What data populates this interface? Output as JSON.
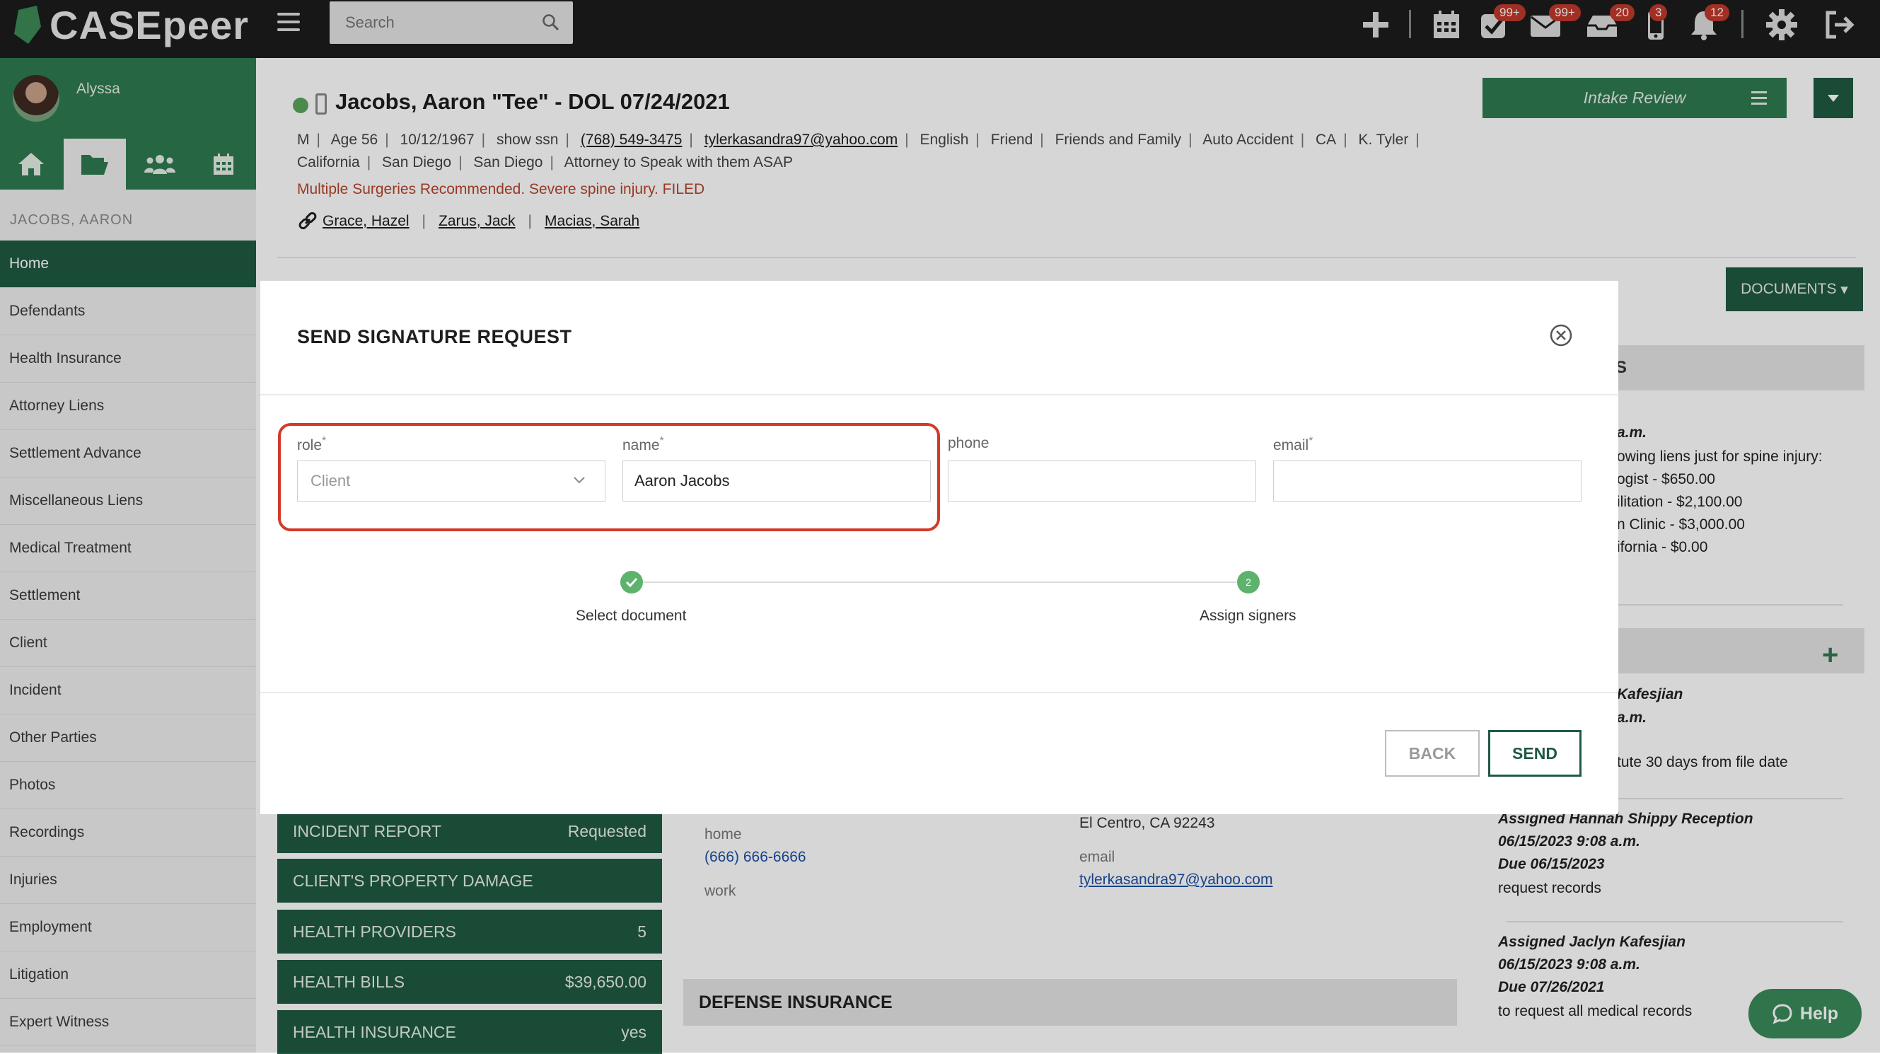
{
  "app": {
    "brand": "CASEpeer"
  },
  "topbar": {
    "search_placeholder": "Search",
    "badges": {
      "tasks": "99+",
      "mail": "99+",
      "inbox": "20",
      "phone": "3",
      "notifications": "12"
    }
  },
  "sidebar": {
    "user_name": "Alyssa",
    "case_label": "JACOBS, AARON",
    "items": [
      "Home",
      "Defendants",
      "Health Insurance",
      "Attorney Liens",
      "Settlement Advance",
      "Miscellaneous Liens",
      "Medical Treatment",
      "Settlement",
      "Client",
      "Incident",
      "Other Parties",
      "Photos",
      "Recordings",
      "Injuries",
      "Employment",
      "Litigation",
      "Expert Witness"
    ]
  },
  "case": {
    "title": "Jacobs, Aaron \"Tee\" - DOL 07/24/2021",
    "meta": {
      "gender": "M",
      "age": "Age 56",
      "dob": "10/12/1967",
      "ssn": "show ssn",
      "phone": "(768) 549-3475",
      "email": "tylerkasandra97@yahoo.com",
      "language": "English",
      "referral": "Friend",
      "referral_source": "Friends and Family",
      "case_type": "Auto Accident",
      "state_abbr": "CA",
      "attorney": "K. Tyler",
      "state": "California",
      "county": "San Diego",
      "city": "San Diego",
      "note": "Attorney to Speak with them ASAP"
    },
    "alert": "Multiple Surgeries Recommended. Severe spine injury. FILED",
    "related": [
      "Grace, Hazel",
      "Zarus, Jack",
      "Macias, Sarah"
    ],
    "intake_button": "Intake Review",
    "documents_button": "DOCUMENTS"
  },
  "right_panel": {
    "header_fragment": "S",
    "lines": [
      "a.m.",
      "owing liens just for spine injury:",
      "ogist - $650.00",
      "ilitation - $2,100.00",
      "n Clinic - $3,000.00",
      "ifornia - $0.00"
    ],
    "task1": {
      "assignee": "Kafesjian",
      "time": "a.m.",
      "desc": "tute 30 days from file date"
    },
    "task2": {
      "assignee": "Assigned Hannah Shippy Reception",
      "time": "06/15/2023 9:08 a.m.",
      "due": "Due 06/15/2023",
      "desc": "request records"
    },
    "task3": {
      "assignee": "Assigned Jaclyn Kafesjian",
      "time": "06/15/2023 9:08 a.m.",
      "due": "Due 07/26/2021",
      "desc": "to request all medical records"
    }
  },
  "sections": [
    {
      "label": "INCIDENT REPORT",
      "value": "Requested"
    },
    {
      "label": "CLIENT'S PROPERTY DAMAGE",
      "value": ""
    },
    {
      "label": "HEALTH PROVIDERS",
      "value": "5"
    },
    {
      "label": "HEALTH BILLS",
      "value": "$39,650.00"
    },
    {
      "label": "HEALTH INSURANCE",
      "value": "yes"
    }
  ],
  "contact": {
    "home_label": "home",
    "home_phone": "(666) 666-6666",
    "work_label": "work",
    "address_line": "El Centro, CA 92243",
    "email_label": "email",
    "email": "tylerkasandra97@yahoo.com"
  },
  "defense_insurance_heading": "DEFENSE INSURANCE",
  "help_label": "Help",
  "modal": {
    "title": "SEND SIGNATURE REQUEST",
    "fields": {
      "role_label": "role",
      "role_value": "Client",
      "name_label": "name",
      "name_value": "Aaron Jacobs",
      "phone_label": "phone",
      "phone_value": "",
      "email_label": "email",
      "email_value": "",
      "required_mark": "*"
    },
    "steps": [
      {
        "label": "Select document",
        "status": "complete"
      },
      {
        "label": "Assign signers",
        "number": "2",
        "status": "current"
      }
    ],
    "back_label": "BACK",
    "send_label": "SEND"
  },
  "colors": {
    "brand_green": "#2f7a4f",
    "dark_green": "#1f5a42",
    "alert_red": "#b5452a",
    "highlight_red": "#d23a2a",
    "badge_red": "#c0392b"
  }
}
